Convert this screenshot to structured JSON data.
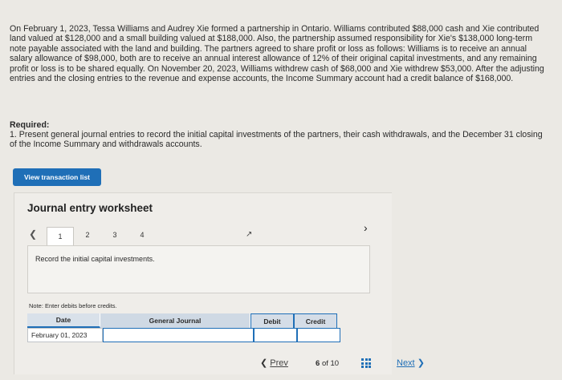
{
  "problem": {
    "text": "On February 1, 2023, Tessa Williams and Audrey Xie formed a partnership in Ontario. Williams contributed $88,000 cash and Xie contributed land valued at $128,000 and a small building valued at $188,000. Also, the partnership assumed responsibility for Xie's $138,000 long-term note payable associated with the land and building. The partners agreed to share profit or loss as follows: Williams is to receive an annual salary allowance of $98,000, both are to receive an annual interest allowance of 12% of their original capital investments, and any remaining profit or loss is to be shared equally. On November 20, 2023, Williams withdrew cash of $68,000 and Xie withdrew $53,000. After the adjusting entries and the closing entries to the revenue and expense accounts, the Income Summary account had a credit balance of $168,000."
  },
  "required": {
    "title": "Required:",
    "text": "1. Present general journal entries to record the initial capital investments of the partners, their cash withdrawals, and the December 31 closing of the Income Summary and withdrawals accounts."
  },
  "view_button": "View transaction list",
  "worksheet": {
    "title": "Journal entry worksheet",
    "tabs": [
      "1",
      "2",
      "3",
      "4"
    ],
    "active_tab": "1",
    "instruction": "Record the initial capital investments.",
    "note": "Note: Enter debits before credits.",
    "table": {
      "headers": {
        "date": "Date",
        "journal": "General Journal",
        "debit": "Debit",
        "credit": "Credit"
      },
      "row": {
        "date": "February 01, 2023",
        "journal": "",
        "debit": "",
        "credit": ""
      }
    }
  },
  "footer": {
    "prev_label": "Prev",
    "page_current": "6",
    "page_of": "of",
    "page_total": "10",
    "next_label": "Next"
  },
  "icons": {
    "prev": "chevron-left-icon",
    "next": "chevron-right-icon",
    "grid": "grid-icon",
    "cursor": "mouse-cursor-icon"
  },
  "colors": {
    "accent": "#1f6fb7",
    "background": "#ebe9e4"
  }
}
